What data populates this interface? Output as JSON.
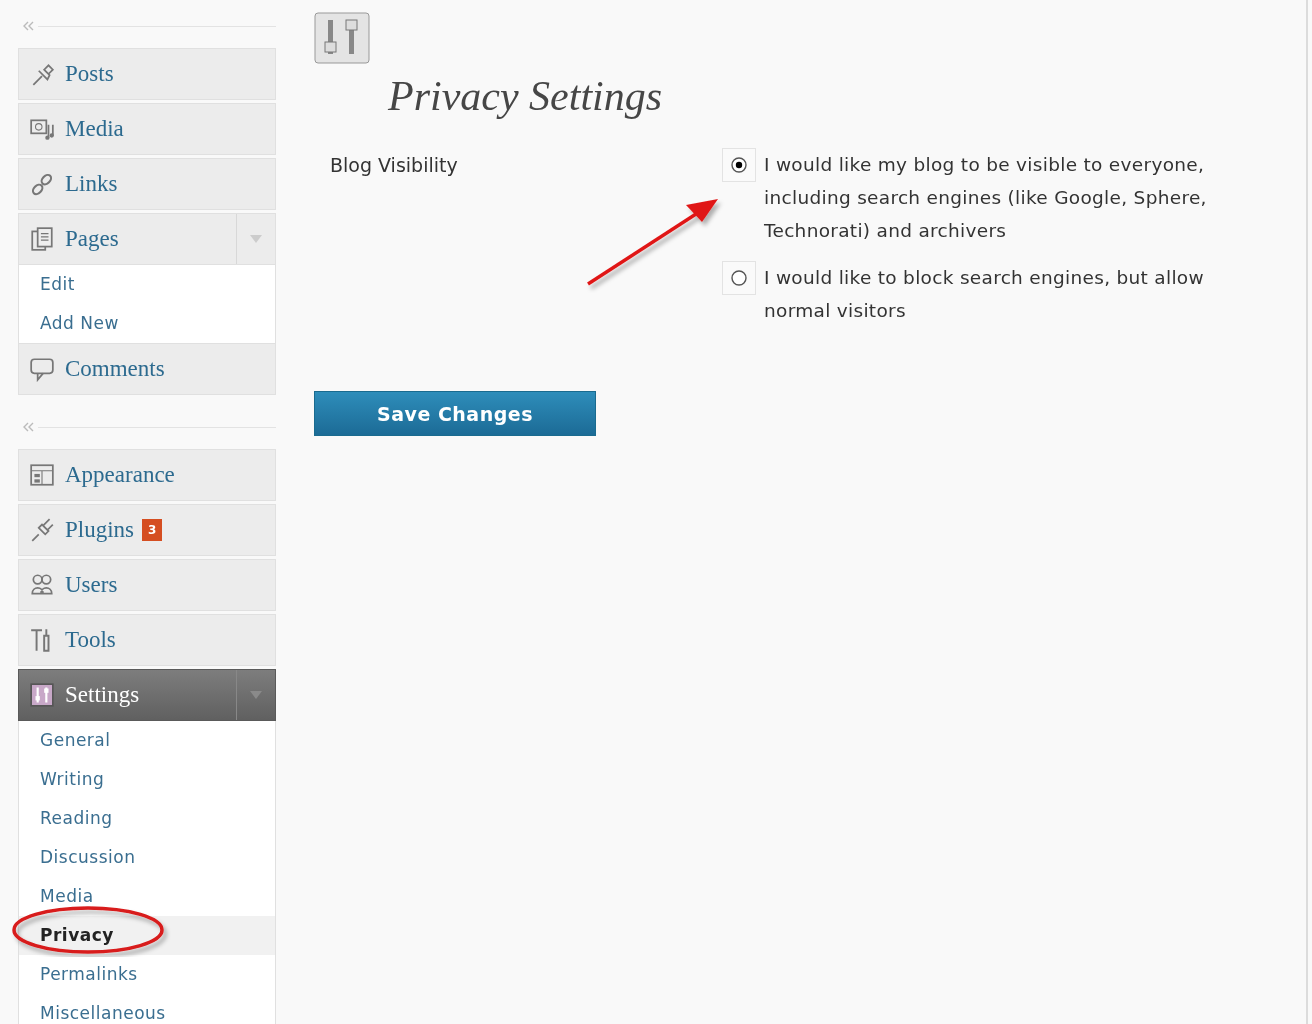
{
  "sidebar": {
    "groups": [
      {
        "items": [
          {
            "label": "Posts",
            "selected": false
          },
          {
            "label": "Media",
            "selected": false
          },
          {
            "label": "Links",
            "selected": false
          },
          {
            "label": "Pages",
            "selected": false,
            "expanded": true,
            "children": [
              {
                "label": "Edit",
                "selected": false
              },
              {
                "label": "Add New",
                "selected": false
              }
            ]
          },
          {
            "label": "Comments",
            "selected": false
          }
        ]
      },
      {
        "items": [
          {
            "label": "Appearance",
            "selected": false
          },
          {
            "label": "Plugins",
            "badge": "3",
            "selected": false
          },
          {
            "label": "Users",
            "selected": false
          },
          {
            "label": "Tools",
            "selected": false
          },
          {
            "label": "Settings",
            "selected": true,
            "expanded": true,
            "children": [
              {
                "label": "General",
                "selected": false
              },
              {
                "label": "Writing",
                "selected": false
              },
              {
                "label": "Reading",
                "selected": false
              },
              {
                "label": "Discussion",
                "selected": false
              },
              {
                "label": "Media",
                "selected": false
              },
              {
                "label": "Privacy",
                "selected": true
              },
              {
                "label": "Permalinks",
                "selected": false
              },
              {
                "label": "Miscellaneous",
                "selected": false
              }
            ]
          }
        ]
      }
    ]
  },
  "main": {
    "title": "Privacy Settings",
    "field_label": "Blog Visibility",
    "options": [
      {
        "label": "I would like my blog to be visible to everyone, including search engines (like Google, Sphere, Technorati) and archivers",
        "selected": true
      },
      {
        "label": "I would like to block search engines, but allow normal visitors",
        "selected": false
      }
    ],
    "save_button": "Save Changes"
  }
}
